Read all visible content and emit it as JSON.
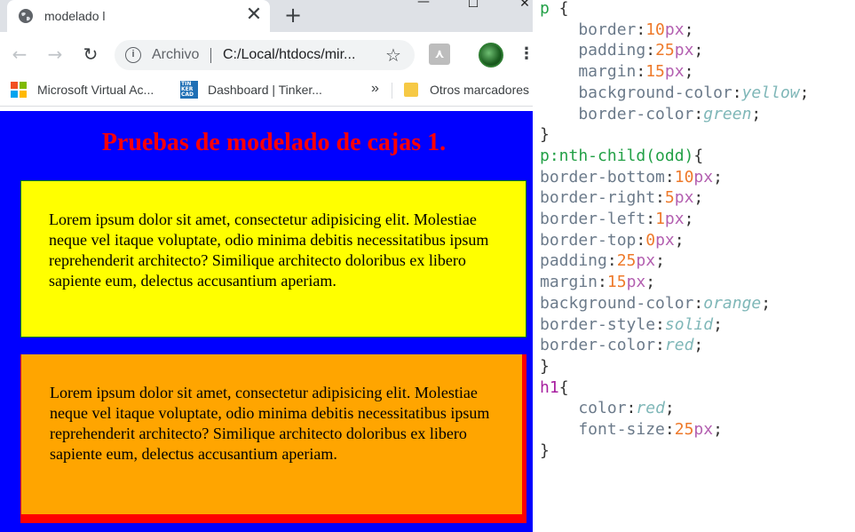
{
  "browser": {
    "tab_title": "modelado l",
    "new_tab": "+",
    "window_controls": {
      "minimize": "—",
      "maximize": "☐",
      "close": "✕"
    },
    "omnibox": {
      "scheme": "Archivo",
      "url": "C:/Local/htdocs/mir..."
    },
    "bookmarks": [
      {
        "label": "Microsoft Virtual Ac..."
      },
      {
        "label": "Dashboard | Tinker..."
      },
      {
        "label": "»"
      },
      {
        "label": "Otros marcadores"
      }
    ]
  },
  "page": {
    "background_color": "#0000ff",
    "title": "Pruebas de modelado de cajas 1.",
    "paragraph1": "Lorem ipsum dolor sit amet, consectetur adipisicing elit. Molestiae neque vel itaque voluptate, odio minima debitis necessitatibus ipsum reprehenderit architecto? Similique architecto doloribus ex libero sapiente eum, delectus accusantium aperiam.",
    "paragraph2": "Lorem ipsum dolor sit amet, consectetur adipisicing elit. Molestiae neque vel itaque voluptate, odio minima debitis necessitatibus ipsum reprehenderit architecto? Similique architecto doloribus ex libero sapiente eum, delectus accusantium aperiam."
  },
  "editor": {
    "lines": [
      [
        [
          "p",
          "sel"
        ],
        [
          " {",
          "punc"
        ]
      ],
      [
        [
          "    border",
          "prop"
        ],
        [
          ":",
          "punc"
        ],
        [
          "10",
          "num"
        ],
        [
          "px",
          "unit"
        ],
        [
          ";",
          "punc"
        ]
      ],
      [
        [
          "    padding",
          "prop"
        ],
        [
          ":",
          "punc"
        ],
        [
          "25",
          "num"
        ],
        [
          "px",
          "unit"
        ],
        [
          ";",
          "punc"
        ]
      ],
      [
        [
          "    margin",
          "prop"
        ],
        [
          ":",
          "punc"
        ],
        [
          "15",
          "num"
        ],
        [
          "px",
          "unit"
        ],
        [
          ";",
          "punc"
        ]
      ],
      [
        [
          "    background-color",
          "prop"
        ],
        [
          ":",
          "punc"
        ],
        [
          "yellow",
          "kw"
        ],
        [
          ";",
          "punc"
        ]
      ],
      [
        [
          "    border-color",
          "prop"
        ],
        [
          ":",
          "punc"
        ],
        [
          "green",
          "kw"
        ],
        [
          ";",
          "punc"
        ]
      ],
      [
        [
          "}",
          "punc"
        ]
      ],
      [
        [
          "p:nth-child(odd)",
          "sel"
        ],
        [
          "{",
          "punc"
        ]
      ],
      [
        [
          "border-bottom",
          "prop"
        ],
        [
          ":",
          "punc"
        ],
        [
          "10",
          "num"
        ],
        [
          "px",
          "unit"
        ],
        [
          ";",
          "punc"
        ]
      ],
      [
        [
          "border-right",
          "prop"
        ],
        [
          ":",
          "punc"
        ],
        [
          "5",
          "num"
        ],
        [
          "px",
          "unit"
        ],
        [
          ";",
          "punc"
        ]
      ],
      [
        [
          "border-left",
          "prop"
        ],
        [
          ":",
          "punc"
        ],
        [
          "1",
          "num"
        ],
        [
          "px",
          "unit"
        ],
        [
          ";",
          "punc"
        ]
      ],
      [
        [
          "border-top",
          "prop"
        ],
        [
          ":",
          "punc"
        ],
        [
          "0",
          "num"
        ],
        [
          "px",
          "unit"
        ],
        [
          ";",
          "punc"
        ]
      ],
      [
        [
          "padding",
          "prop"
        ],
        [
          ":",
          "punc"
        ],
        [
          "25",
          "num"
        ],
        [
          "px",
          "unit"
        ],
        [
          ";",
          "punc"
        ]
      ],
      [
        [
          "margin",
          "prop"
        ],
        [
          ":",
          "punc"
        ],
        [
          "15",
          "num"
        ],
        [
          "px",
          "unit"
        ],
        [
          ";",
          "punc"
        ]
      ],
      [
        [
          "background-color",
          "prop"
        ],
        [
          ":",
          "punc"
        ],
        [
          "orange",
          "kw"
        ],
        [
          ";",
          "punc"
        ]
      ],
      [
        [
          "border-style",
          "prop"
        ],
        [
          ":",
          "punc"
        ],
        [
          "solid",
          "kw"
        ],
        [
          ";",
          "punc"
        ]
      ],
      [
        [
          "border-color",
          "prop"
        ],
        [
          ":",
          "punc"
        ],
        [
          "red",
          "kw"
        ],
        [
          ";",
          "punc"
        ]
      ],
      [
        [
          "}",
          "punc"
        ]
      ],
      [
        [
          "h1",
          "sel2"
        ],
        [
          "{",
          "punc"
        ]
      ],
      [
        [
          "    color",
          "prop"
        ],
        [
          ":",
          "punc"
        ],
        [
          "red",
          "kw"
        ],
        [
          ";",
          "punc"
        ]
      ],
      [
        [
          "    font-size",
          "prop"
        ],
        [
          ":",
          "punc"
        ],
        [
          "25",
          "num"
        ],
        [
          "px",
          "unit"
        ],
        [
          ";",
          "punc"
        ]
      ],
      [
        [
          "}",
          "punc"
        ]
      ]
    ]
  },
  "icons": {
    "tab": "globe-icon",
    "back": "back-arrow-icon",
    "forward": "forward-arrow-icon",
    "reload": "reload-icon",
    "info": "info-icon",
    "star": "star-icon",
    "pdf": "acrobat-icon",
    "menu": "kebab-menu-icon"
  },
  "colors": {
    "box1_bg": "#ffff00",
    "box1_border": "#008000",
    "box2_bg": "#ffa500",
    "box2_border": "#ff0000",
    "h1": "#ff0000"
  }
}
